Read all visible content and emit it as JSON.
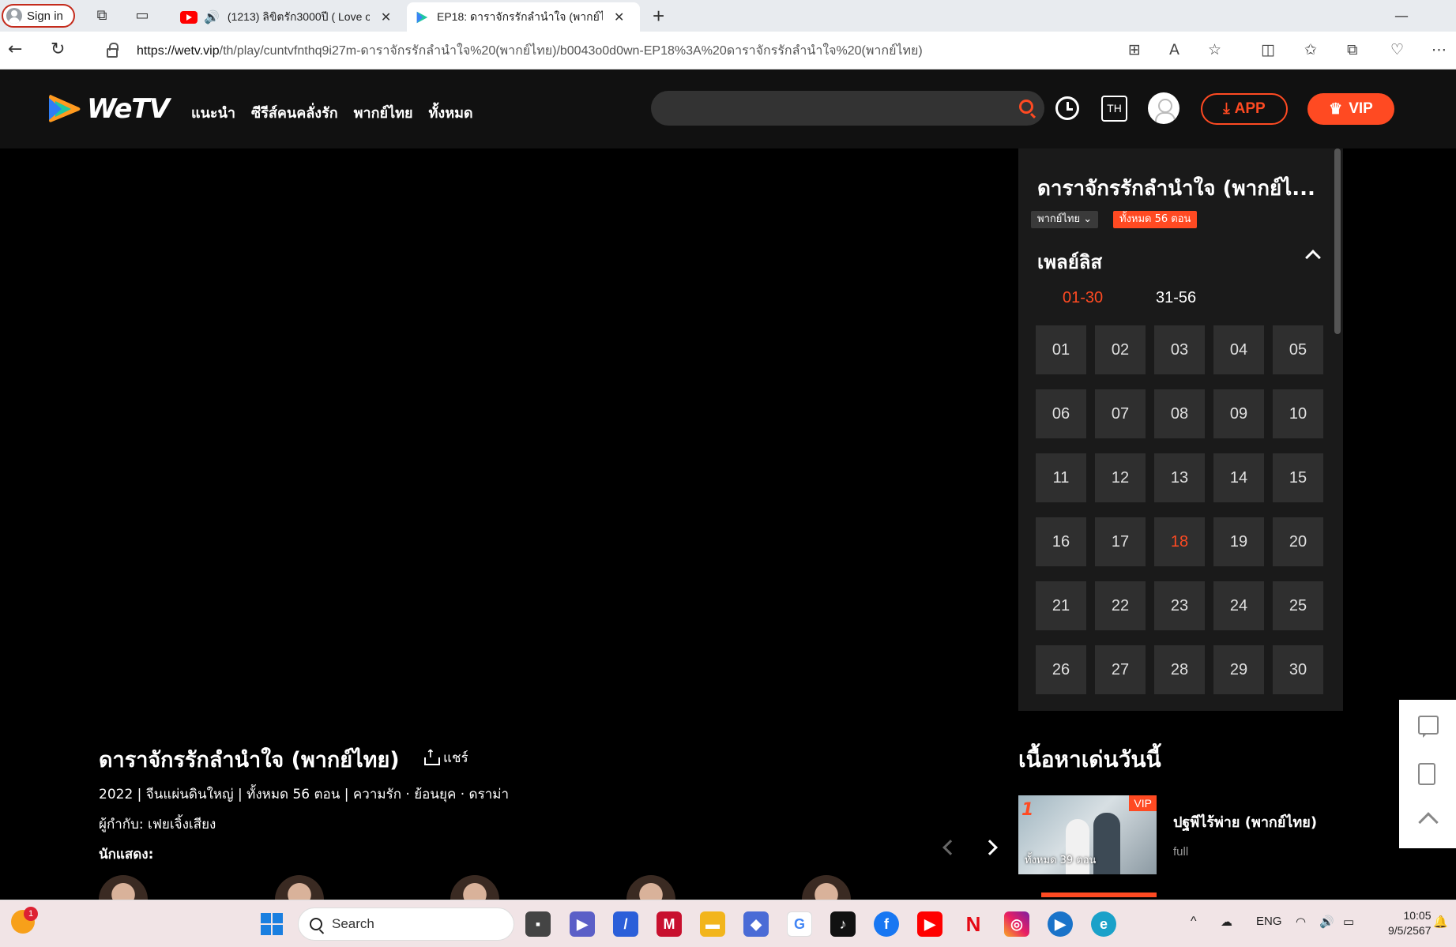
{
  "browser": {
    "signin_label": "Sign in",
    "tabs": [
      {
        "title": "(1213) ลิขิตรัก3000ปี ( Love o"
      },
      {
        "title": "EP18: ดาราจักรรักลำนำใจ (พากย์ไทย"
      }
    ],
    "url_domain": "https://wetv.vip",
    "url_path": "/th/play/cuntvfnthq9i27m-ดาราจักรรักลำนำใจ%20(พากย์ไทย)/b0043o0d0wn-EP18%3A%20ดาราจักรรักลำนำใจ%20(พากย์ไทย)"
  },
  "header": {
    "logo_text": "WeTV",
    "nav": [
      "แนะนำ",
      "ซีรีส์คนคลั่งรัก",
      "พากย์ไทย",
      "ทั้งหมด"
    ],
    "lang": "TH",
    "app_label": "APP",
    "vip_label": "VIP",
    "accent": "#ff4a22"
  },
  "panel": {
    "title": "ดาราจักรรักลำนำใจ (พากย์ไ...",
    "dub_select": "พากย์ไทย",
    "episode_count": "ทั้งหมด 56 ตอน",
    "playlist_label": "เพลย์ลิส",
    "ranges": [
      "01-30",
      "31-56"
    ],
    "active_range": "01-30",
    "episodes": [
      "01",
      "02",
      "03",
      "04",
      "05",
      "06",
      "07",
      "08",
      "09",
      "10",
      "11",
      "12",
      "13",
      "14",
      "15",
      "16",
      "17",
      "18",
      "19",
      "20",
      "21",
      "22",
      "23",
      "24",
      "25",
      "26",
      "27",
      "28",
      "29",
      "30"
    ],
    "active_episode": "18"
  },
  "info": {
    "title": "ดาราจักรรักลำนำใจ (พากย์ไทย)",
    "share_label": "แชร์",
    "meta": "2022 | จีนแผ่นดินใหญ่ | ทั้งหมด 56 ตอน | ความรัก · ย้อนยุค · ดราม่า",
    "director": "ผู้กำกับ: เฟยเจิ้งเสียง",
    "cast_label": "นักแสดง:"
  },
  "today": {
    "heading": "เนื้อหาเด่นวันนี้",
    "items": [
      {
        "rank": "1",
        "badge": "VIP",
        "episodes": "ทั้งหมด 39 ตอน",
        "name": "ปฐพีไร้พ่าย (พากย์ไทย)",
        "sub": "full"
      }
    ]
  },
  "taskbar": {
    "search_placeholder": "Search",
    "notif_count": "1",
    "lang": "ENG",
    "time": "10:05",
    "date": "9/5/2567"
  }
}
